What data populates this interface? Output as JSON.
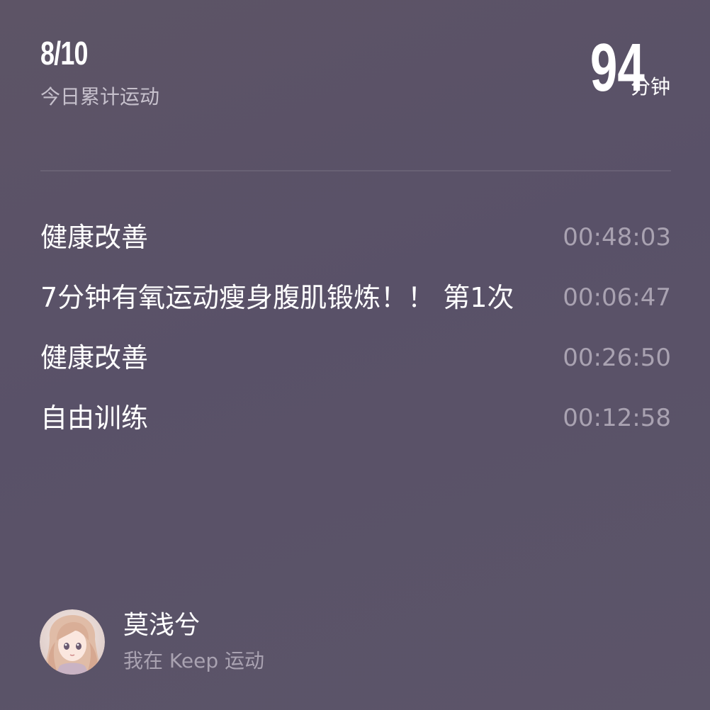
{
  "summary": {
    "date": "8/10",
    "subtitle": "今日累计运动",
    "total_minutes": "94",
    "unit": "分钟"
  },
  "activities": [
    {
      "name": "健康改善",
      "duration": "00:48:03"
    },
    {
      "name": "7分钟有氧运动瘦身腹肌锻炼！！  第1次",
      "duration": "00:06:47"
    },
    {
      "name": "健康改善",
      "duration": "00:26:50"
    },
    {
      "name": "自由训练",
      "duration": "00:12:58"
    }
  ],
  "user": {
    "name": "莫浅兮",
    "tagline": "我在 Keep 运动",
    "avatar_icon": "avatar-portrait"
  },
  "colors": {
    "background": "#5b5367",
    "primary_text": "#ffffff",
    "secondary_text": "#a9a2b1"
  }
}
